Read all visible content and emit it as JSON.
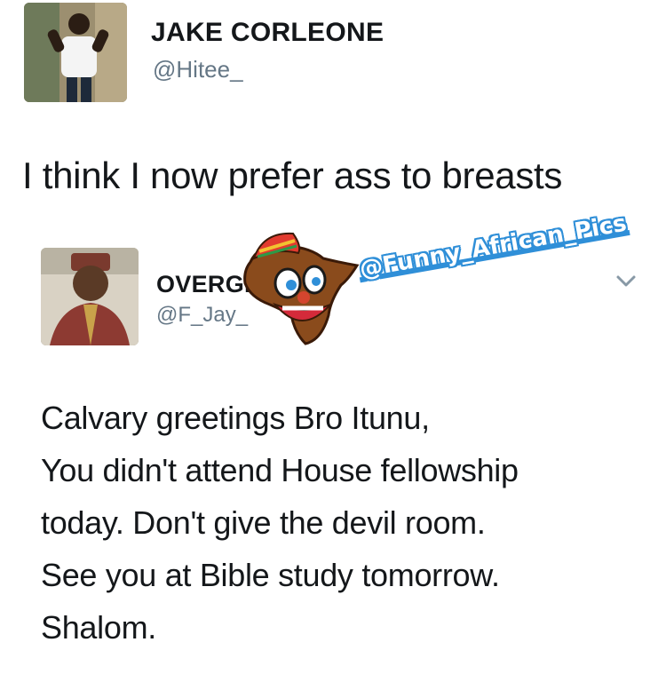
{
  "tweet": {
    "author_name": "JAKE CORLEONE",
    "author_handle": "@Hitee_",
    "text": "I think I now prefer ass to breasts"
  },
  "reply": {
    "author_name": "OVERGR",
    "author_handle": "@F_Jay_",
    "lines": [
      "Calvary greetings Bro Itunu,",
      "You didn't attend House fellowship",
      "today. Don't give the devil room.",
      "See you at Bible study tomorrow.",
      "Shalom."
    ]
  },
  "watermark": {
    "text": "@Funny_African_Pics"
  },
  "icons": {
    "menu": "chevron-down-icon",
    "mascot": "africa-mascot-icon"
  },
  "colors": {
    "text": "#14171a",
    "handle": "#657786",
    "watermark": "#2f8fd8"
  }
}
